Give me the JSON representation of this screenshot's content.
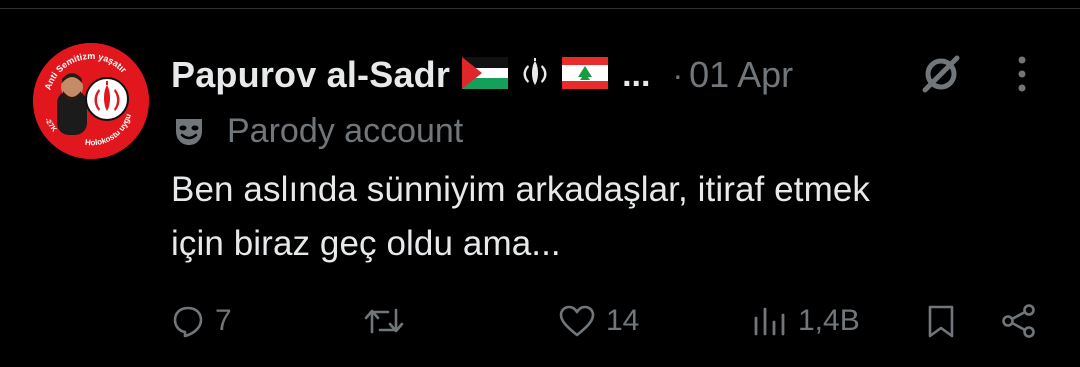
{
  "tweet": {
    "author": {
      "display_name": "Papurov al-Sadr",
      "name_emojis": [
        "palestine-flag",
        "iran-emblem",
        "lebanon-flag"
      ],
      "name_truncation": "...",
      "avatar_text": {
        "top": "Anti Semitizm yaşatır",
        "bottom": "Holokostu uygula",
        "left": "-27K"
      }
    },
    "separator": "·",
    "date": "01 Apr",
    "parody_label": "Parody account",
    "text_lines": [
      "Ben aslında sünniyim arkadaşlar, itiraf etmek",
      "için biraz geç oldu ama..."
    ],
    "actions": {
      "replies": "7",
      "retweets": "",
      "likes": "14",
      "views": "1,4B"
    }
  },
  "icons": {
    "reply": "speech-bubble-icon",
    "retweet": "retweet-icon",
    "like": "heart-icon",
    "views": "bar-chart-icon",
    "bookmark": "bookmark-icon",
    "share": "share-icon",
    "grok": "grok-icon",
    "more": "more-vertical-icon",
    "parody": "theater-masks-icon"
  },
  "colors": {
    "background": "#000000",
    "primary_text": "#e7e9ea",
    "secondary_text": "#71767b",
    "avatar_red": "#e1171d"
  }
}
